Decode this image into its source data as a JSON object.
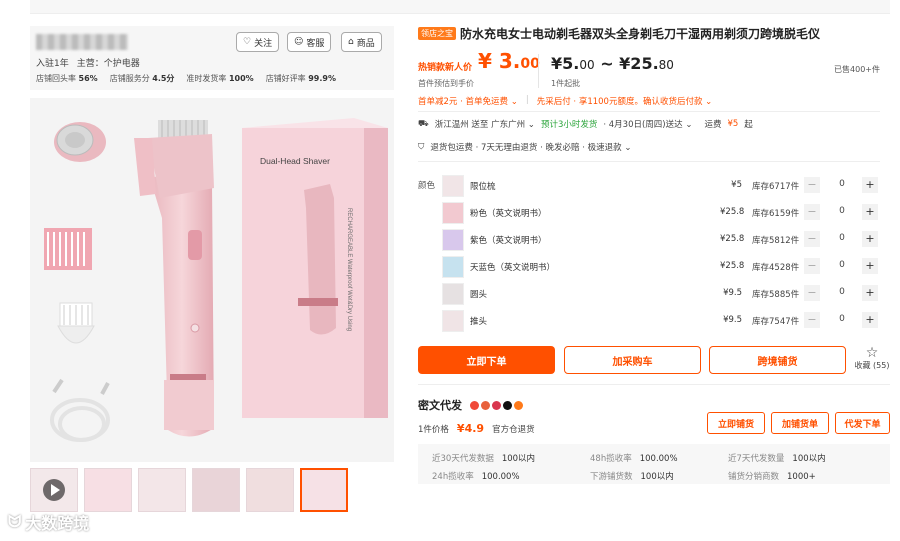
{
  "store": {
    "follow": "关注",
    "service": "客服",
    "goods": "商品",
    "meta": [
      "入驻1年",
      "主营：个护电器"
    ],
    "metrics": [
      {
        "label": "店铺回头率",
        "value": "56%"
      },
      {
        "label": "店铺服务分",
        "value": "4.5分"
      },
      {
        "label": "准时发货率",
        "value": "100%"
      },
      {
        "label": "店铺好评率",
        "value": "99.9%"
      }
    ]
  },
  "gallery": {
    "product_box_text": "Dual-Head Shaver",
    "box_side_text": "RECHARGEABLE Waterproof Wet&Dry Using",
    "watermark": "大数跨境"
  },
  "product": {
    "badge": "领店之宝",
    "title": "防水充电女士电动剃毛器双头全身剃毛刀干湿两用剃须刀跨境脱毛仪",
    "hot_label": "热销款新人价",
    "hot_price_int": "¥ 3.",
    "hot_price_dec": "00",
    "hot_sub": "首件预估到手价",
    "range_from": "¥5.",
    "range_from_dec": "00",
    "range_to": "¥25.",
    "range_to_dec": "80",
    "min_order": "1件起批",
    "sold": "已售400+件",
    "promo1": "首单减2元 · 首单免运费 ⌄",
    "promo2": "先采后付 · 享1100元额度。确认收货后付款 ⌄",
    "ship_from": "浙江温州 送至 广东广州 ⌄",
    "ship_time": "预计3小时发货",
    "ship_arrive": "· 4月30日(周四)送达 ⌄",
    "freight_label": "运费",
    "freight_value": "¥5",
    "freight_suffix": "起",
    "services": "退货包运费 · 7天无理由退货 · 晚发必赔 · 极速退款 ⌄"
  },
  "skus": {
    "label": "颜色",
    "items": [
      {
        "name": "限位梳",
        "price": "¥5",
        "stock": "库存6717件",
        "qty": "0"
      },
      {
        "name": "粉色（英文说明书）",
        "price": "¥25.8",
        "stock": "库存6159件",
        "qty": "0"
      },
      {
        "name": "紫色（英文说明书）",
        "price": "¥25.8",
        "stock": "库存5812件",
        "qty": "0"
      },
      {
        "name": "天蓝色（英文说明书）",
        "price": "¥25.8",
        "stock": "库存4528件",
        "qty": "0"
      },
      {
        "name": "圆头",
        "price": "¥9.5",
        "stock": "库存5885件",
        "qty": "0"
      },
      {
        "name": "推头",
        "price": "¥9.5",
        "stock": "库存7547件",
        "qty": "0"
      }
    ]
  },
  "actions": {
    "buy": "立即下单",
    "cart": "加采购车",
    "crossborder": "跨境铺货",
    "fav": "收藏 (55)"
  },
  "dropship": {
    "title": "密文代发",
    "price_label": "1件价格",
    "price": "¥4.9",
    "warehouse": "官方仓退货",
    "btn1": "立即铺货",
    "btn2": "加铺货单",
    "btn3": "代发下单",
    "stats": [
      {
        "label": "近30天代发数据",
        "value": "100以内"
      },
      {
        "label": "48h揽收率",
        "value": "100.00%"
      },
      {
        "label": "近7天代发数量",
        "value": "100以内"
      },
      {
        "label": "24h揽收率",
        "value": "100.00%"
      },
      {
        "label": "下游铺货数",
        "value": "100以内"
      },
      {
        "label": "铺货分销商数",
        "value": "1000+"
      }
    ]
  }
}
